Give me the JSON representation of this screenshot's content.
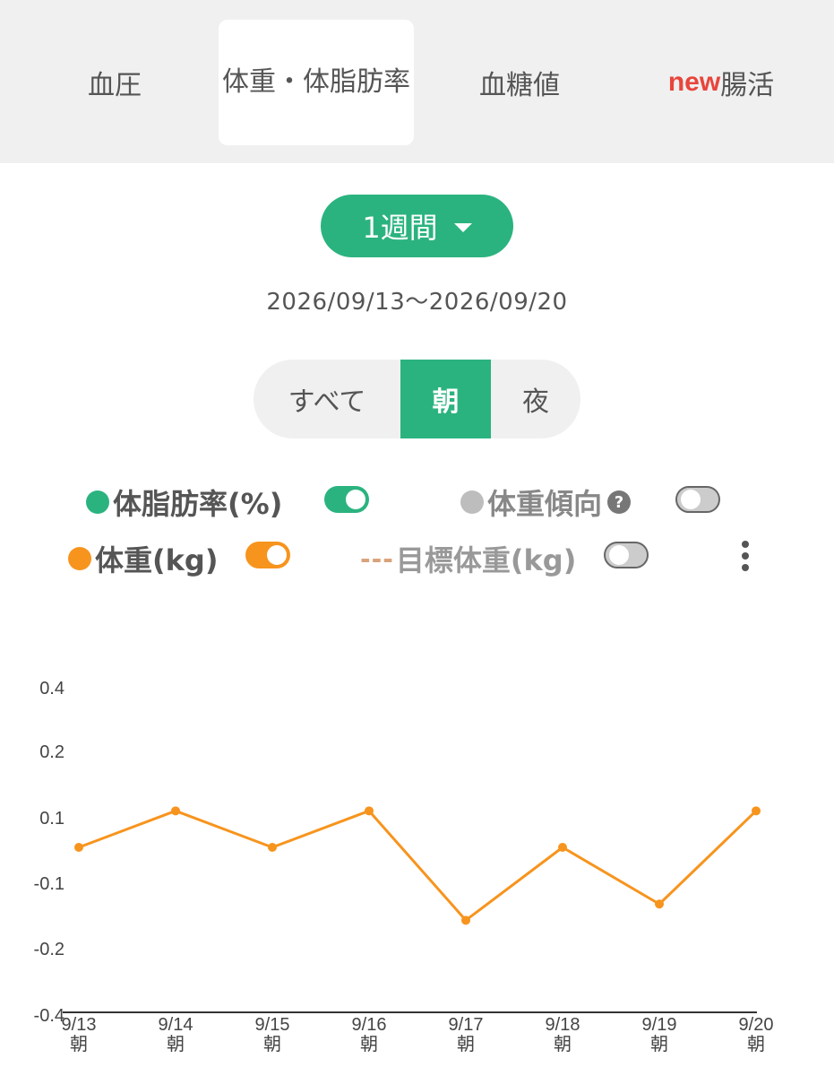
{
  "tabs": [
    {
      "label": "血圧",
      "active": false
    },
    {
      "label": "体重・体脂肪率",
      "active": true
    },
    {
      "label": "血糖値",
      "active": false
    },
    {
      "badge": "new",
      "label": "腸活",
      "active": false
    }
  ],
  "period": {
    "label": "1週間"
  },
  "date_range": "2026/09/13〜2026/09/20",
  "segments": [
    {
      "label": "すべて",
      "active": false
    },
    {
      "label": "朝",
      "active": true
    },
    {
      "label": "夜",
      "active": false
    }
  ],
  "legend": {
    "body_fat": {
      "label": "体脂肪率(%)",
      "color": "#2bb37f",
      "toggle_on": true
    },
    "weight_trend": {
      "label": "体重傾向",
      "help": "?",
      "color": "#bdbdbd",
      "toggle_on": false
    },
    "weight": {
      "label": "体重(kg)",
      "color": "#f7941d",
      "toggle_on": true
    },
    "target_weight": {
      "prefix": "---",
      "label": "目標体重(kg)",
      "color": "#d9a27a",
      "toggle_on": false
    }
  },
  "chart_data": {
    "type": "line",
    "y_tick_labels": [
      "0.4",
      "0.2",
      "0.1",
      "-0.1",
      "-0.2",
      "-0.4"
    ],
    "x": [
      "9/13",
      "9/14",
      "9/15",
      "9/16",
      "9/17",
      "9/18",
      "9/19",
      "9/20"
    ],
    "x_sublabel": "朝",
    "series": [
      {
        "color": "#f7941d",
        "values": [
          0.05,
          0.14,
          0.05,
          0.14,
          -0.13,
          0.05,
          -0.09,
          0.14
        ]
      }
    ]
  }
}
